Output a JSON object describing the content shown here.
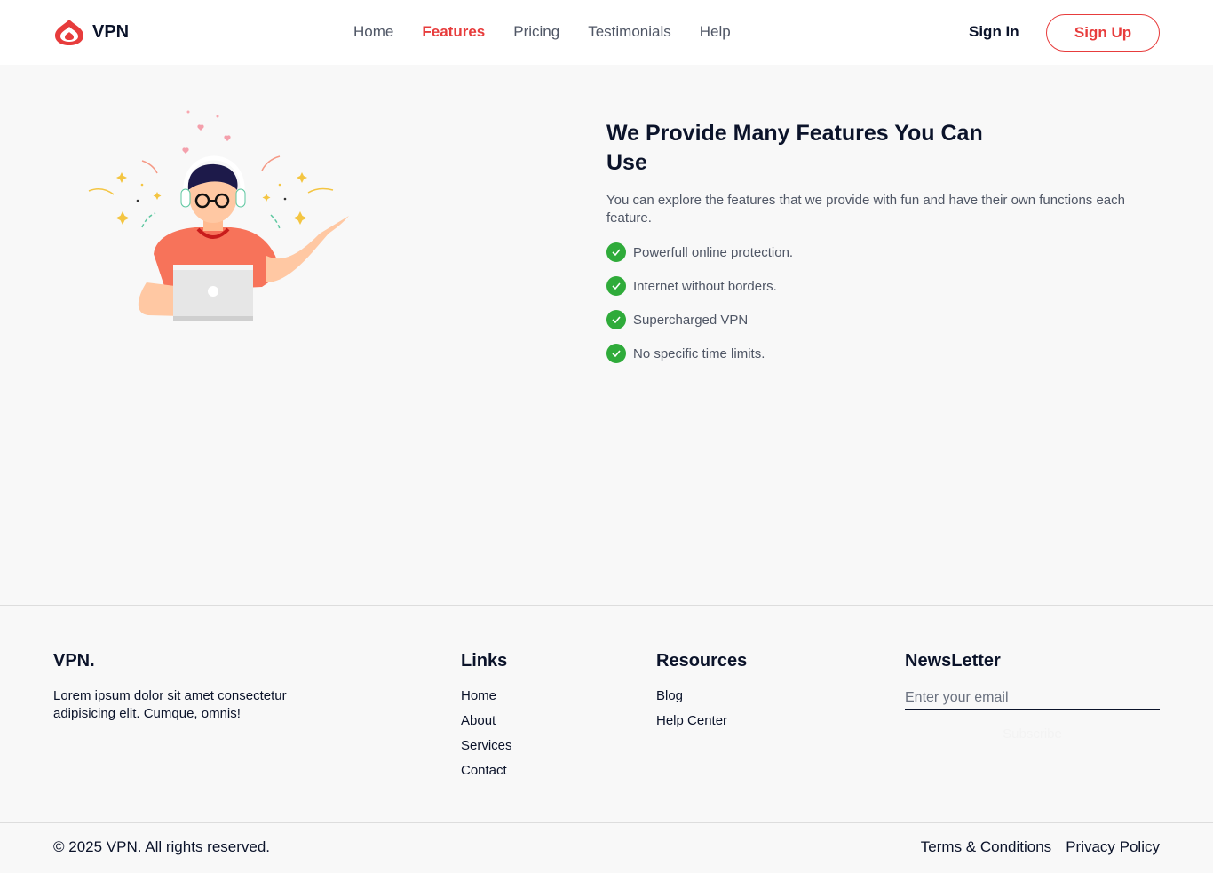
{
  "header": {
    "brand": "VPN",
    "nav": [
      "Home",
      "Features",
      "Pricing",
      "Testimonials",
      "Help"
    ],
    "active_nav": "Features",
    "signin_label": "Sign In",
    "signup_label": "Sign Up"
  },
  "hero": {
    "title": "We Provide Many Features You Can Use",
    "description": "You can explore the features that we provide with fun and have their own functions each feature.",
    "features": [
      "Powerfull online protection.",
      "Internet without borders.",
      "Supercharged VPN",
      "No specific time limits."
    ]
  },
  "footer": {
    "brand": "VPN.",
    "brand_desc": "Lorem ipsum dolor sit amet consectetur adipisicing elit. Cumque, omnis!",
    "links_title": "Links",
    "links": [
      "Home",
      "About",
      "Services",
      "Contact"
    ],
    "resources_title": "Resources",
    "resources": [
      "Blog",
      "Help Center"
    ],
    "newsletter_title": "NewsLetter",
    "newsletter_placeholder": "Enter your email",
    "subscribe_label": "Subscribe",
    "copyright": "© 2025 VPN. All rights reserved.",
    "legal": [
      "Terms & Conditions",
      "Privacy Policy"
    ]
  },
  "colors": {
    "accent": "#e73c3c",
    "check": "#2fab3a",
    "text_dark": "#0b132a",
    "text_muted": "#4f5665"
  },
  "icons": {
    "logo": "vpn-shield-logo",
    "check": "check-circle-icon",
    "illustration": "person-with-laptop-illustration"
  }
}
